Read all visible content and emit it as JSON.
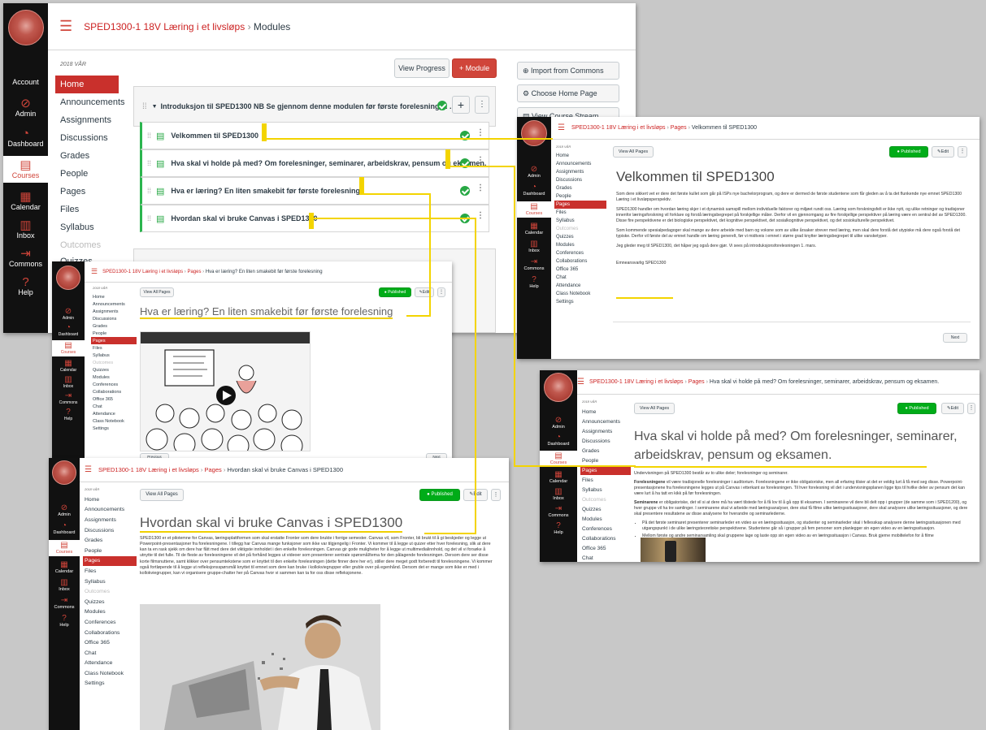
{
  "global_nav": {
    "account": "Account",
    "admin": "Admin",
    "dashboard": "Dashboard",
    "courses": "Courses",
    "calendar": "Calendar",
    "inbox": "Inbox",
    "commons": "Commons",
    "help": "Help"
  },
  "breadcrumb": {
    "course": "SPED1300-1 18V Læring i et livsløps",
    "modules": "Modules",
    "pages": "Pages",
    "sep": "›"
  },
  "course_nav": {
    "term": "2018 VÅR",
    "items": [
      "Home",
      "Announcements",
      "Assignments",
      "Discussions",
      "Grades",
      "People",
      "Pages",
      "Files",
      "Syllabus",
      "Outcomes",
      "Quizzes",
      "Modules",
      "Conferences",
      "Collaborations",
      "Office 365",
      "Chat",
      "Attendance",
      "Class Notebook",
      "Settings"
    ]
  },
  "modules_page": {
    "view_progress": "View Progress",
    "add_module": "+ Module",
    "import_commons": "Import from Commons",
    "choose_home": "Choose Home Page",
    "view_stream": "View Course Stream",
    "module_title": "Introduksjon til SPED1300 NB Se gjennom denne modulen før første forelesning 1. ...",
    "items": [
      "Velkommen til SPED1300",
      "Hva skal vi holde på med? Om forelesninger, seminarer, arbeidskrav, pensum og eksamen.",
      "Hva er læring? En liten smakebit før første forelesning",
      "Hvordan skal vi bruke Canvas i SPED1300"
    ],
    "partial_nav_label": "Quizzes"
  },
  "page_controls": {
    "view_all": "View All Pages",
    "published": "Published",
    "edit": "Edit",
    "previous": "Previous",
    "next": "Next"
  },
  "velkommen": {
    "title": "Velkommen til SPED1300",
    "p1": "Som dere sikkert vet er dere det første kullet som går på ISPs nye bachelorprogram, og dere er dermed de første studentene som får gleden av å ta det flunkende nye emnet SPED1300 Læring i et livsløpsperspektiv.",
    "p2": "SPED1300 handler om hvordan læring skjer i et dynamisk samspill mellom individuelle faktorer og miljøet rundt oss. Læring som forskningsfelt er ikke nytt, og ulike retninger og tradisjoner innenfor læringsforskning vil forklare og forstå læringsbegrepet på forskjellige måter. Derfor vil en gjennomgang av fire forskjellige perspektiver på læring være en sentral del av SPED1300. Disse fire perspektivene er det biologiske perspektivet, det kognitive perspektivet, det sosialkognitive perspektivet, og det sosiokulturelle perspektivet.",
    "p3": "Som kommende spesialpedagoger skal mange av dere arbeide med barn og voksne som av ulike årsaker strever med læring, men skal dere forstå det utypiske må dere også forstå det typiske. Derfor vil første del av emnet handle om læring generelt, før vi midtveis i emnet i større grad knytter læringsbegrepet til ulike vansketyper.",
    "p4": "Jeg gleder meg til SPED1300, det håper jeg også dere gjør. Vi sees på introduksjonsforelesningen 1. mars.",
    "sign": "Emneansvarlig SPED1300"
  },
  "hva_laering": {
    "title": "Hva er læring? En liten smakebit før første forelesning"
  },
  "hva_holde": {
    "title": "Hva skal vi holde på med? Om forelesninger, seminarer, arbeidskrav, pensum og eksamen.",
    "intro": "Undervisningen på SPED1300 består av to ulike deler; forelesninger og seminarer.",
    "p1_bold": "Forelesningene",
    "p1": " vil være tradisjonelle forelesninger i auditorium. Forelesningene er ikke obligatoriske, men all erfaring tilsier at det er veldig lurt å få med seg disse. Powerpoint-presentasjonene fra forelesningene legges ut på Canvas i etterkant av forelesningen. Til hver forelesning vil det i undervisningsplanen ligge tips til hvilke deler av pensum det kan være lurt å ha tatt en kikk på før forelesningen.",
    "p2_bold": "Seminarene",
    "p2": " er obligatoriske, det vil si at dere må ha vært tilstede for å få lov til å gå opp til eksamen. I seminarene vil dere bli delt opp i grupper (de samme som i SPED1200), og hver gruppe vil ha tre samlinger. I seminarene skal vi arbeide med læringsanalyser, dere skal få filme ulike læringssituasjoner, dere skal analysere ulike læringssituasjoner, og dere skal presentere resultatene av disse analysene for hverandre og seminarlederne.",
    "b1": "På det første seminaret presenterer seminarleder en video av en læringssituasjon, og studenter og seminarleder skal i fellesskap analysere denne læringssituasjonen med utgangspunkt i de ulike læringsteoretiske perspektivene. Studentene går så i grupper på fem personer som planlegger sin egen video av en læringssituasjon.",
    "b2": "Mellom første og andre seminarsamling skal gruppene lage og laste opp sin egen video av en læringssituasjon i Canvas. Bruk gjerne mobiltelefon for å filme"
  },
  "hvordan_canvas": {
    "title": "Hvordan skal vi bruke Canvas i SPED1300",
    "p1": "SPED1300 er et pilotemne for Canvas, læringsplattformen som skal erstatte Fronter som dere brukte i forrige semester. Canvas vil, som Fronter, bli brukt til å gi beskjeder og legge ut Powerpoint-presentasjoner fra forelesningene. I tillegg har Canvas mange funksjoner som ikke var tilgjengelig i Fronter. Vi kommer til å legge ut quizer etter hver forelesning, slik at dere kan ta en rask sjekk om dere har fått med dere det viktigste innholdet i den enkelte forelesningen. Canvas gir gode muligheter for å legge ut multimedialinnhold, og det vil vi forsøke å utnytte til det fulle. Til de fleste av forelesningene vil det på forhånd legges ut videoer som presenterer sentrale spørsmål/tema for den pålagende forelesningen. Dersom dere ser disse korte filmsnuttene, samt klikker over pensumtekstene som er knyttet til den enkelte forelesningen (dette finner dere her er), stiller dere meget godt forberedt til forelesningene. Vi kommer også fortløpende til å legge ut refleksjonsspørsmål knyttet til emnet som dere kan bruke i kollokviegrupper eller gruble over på egenhånd. Dersom det er mange som ikke er med i kollokviegrupper, kan vi organisere gruppe-chatter her på Canvas hvor vi sammen kan ta for oss disse refleksjonene."
  },
  "colors": {
    "accent_red": "#d0453a",
    "published_green": "#00ac18",
    "highlight_yellow": "#f3d400",
    "module_check": "#27a844"
  }
}
